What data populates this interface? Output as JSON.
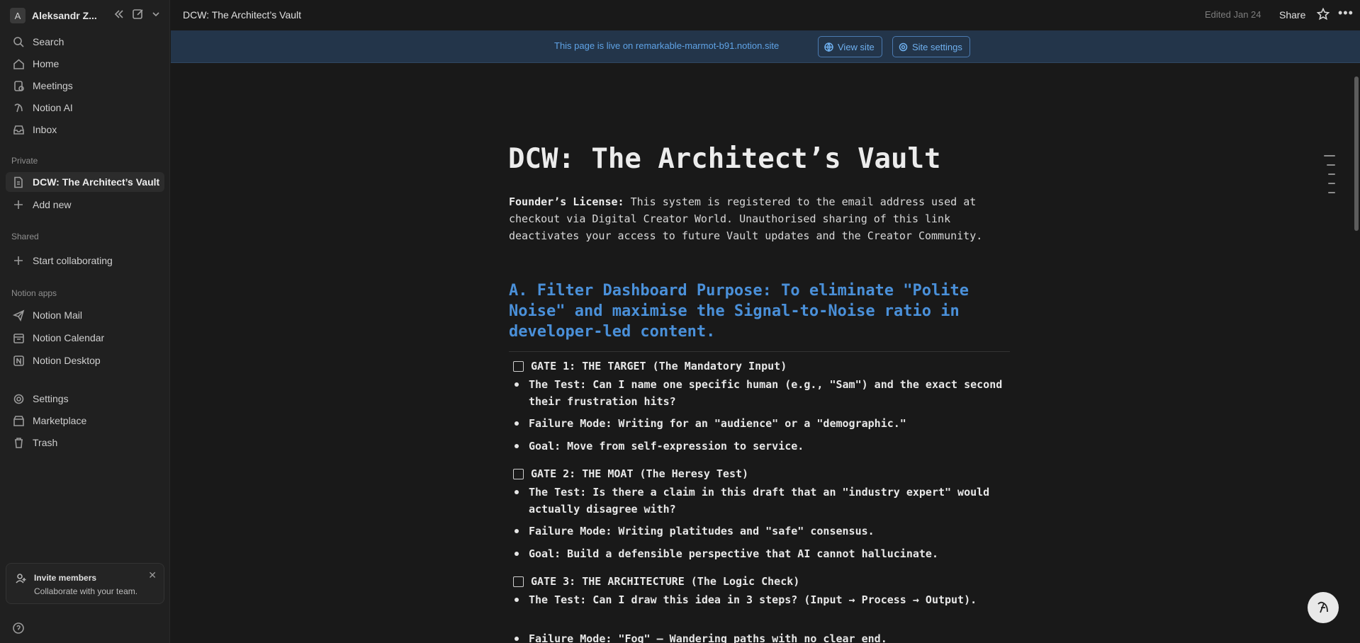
{
  "workspace": {
    "avatar_letter": "A",
    "name": "Aleksandr Z..."
  },
  "sidebar": {
    "top_items": [
      {
        "label": "Search",
        "icon": "search-icon"
      },
      {
        "label": "Home",
        "icon": "home-icon"
      },
      {
        "label": "Meetings",
        "icon": "meetings-icon"
      },
      {
        "label": "Notion AI",
        "icon": "notion-ai-icon"
      },
      {
        "label": "Inbox",
        "icon": "inbox-icon"
      }
    ],
    "private_label": "Private",
    "private_items": [
      {
        "label": "DCW: The Architect’s Vault",
        "icon": "page-icon"
      },
      {
        "label": "Add new",
        "icon": "plus-icon"
      }
    ],
    "shared_label": "Shared",
    "shared_items": [
      {
        "label": "Start collaborating",
        "icon": "plus-icon"
      }
    ],
    "apps_label": "Notion apps",
    "apps_items": [
      {
        "label": "Notion Mail",
        "icon": "mail-icon"
      },
      {
        "label": "Notion Calendar",
        "icon": "calendar-icon"
      },
      {
        "label": "Notion Desktop",
        "icon": "desktop-icon"
      }
    ],
    "bottom_items": [
      {
        "label": "Settings",
        "icon": "gear-icon"
      },
      {
        "label": "Marketplace",
        "icon": "marketplace-icon"
      },
      {
        "label": "Trash",
        "icon": "trash-icon"
      }
    ],
    "invite": {
      "title": "Invite members",
      "subtitle": "Collaborate with your team."
    }
  },
  "topbar": {
    "breadcrumb": "DCW: The Architect’s Vault",
    "edited": "Edited Jan 24",
    "share_label": "Share"
  },
  "banner": {
    "text": "This page is live on remarkable-marmot-b91.notion.site",
    "view_site": "View site",
    "site_settings": "Site settings"
  },
  "page": {
    "title": "DCW: The Architect’s Vault",
    "license_label": "Founder’s License:",
    "license_text": " This system is registered to the email address used at checkout via Digital Creator World. Unauthorised sharing of this link deactivates your access to future Vault updates and the Creator Community.",
    "section_heading": "A. Filter Dashboard Purpose: To eliminate \"Polite Noise\" and maximise the Signal-to-Noise ratio in developer-led content.",
    "gate1": "GATE 1: THE TARGET (The Mandatory Input)",
    "gate1_b1": "The Test: Can I name one specific human (e.g., \"Sam\") and the exact second their frustration hits?",
    "gate1_b2": "Failure Mode: Writing for an \"audience\" or a \"demographic.\"",
    "gate1_b3": "Goal: Move from self-expression to service.",
    "gate2": "GATE 2: THE MOAT (The Heresy Test)",
    "gate2_b1": "The Test: Is there a claim in this draft that an \"industry expert\" would actually disagree with?",
    "gate2_b2": "Failure Mode: Writing platitudes and \"safe\" consensus.",
    "gate2_b3": "Goal: Build a defensible perspective that AI cannot hallucinate.",
    "gate3": "GATE 3: THE ARCHITECTURE (The Logic Check)",
    "gate3_b1": "The Test: Can I draw this idea in 3 steps? (Input → Process → Output).",
    "gate3_b2": "Failure Mode: \"Fog\" — Wandering paths with no clear end."
  }
}
